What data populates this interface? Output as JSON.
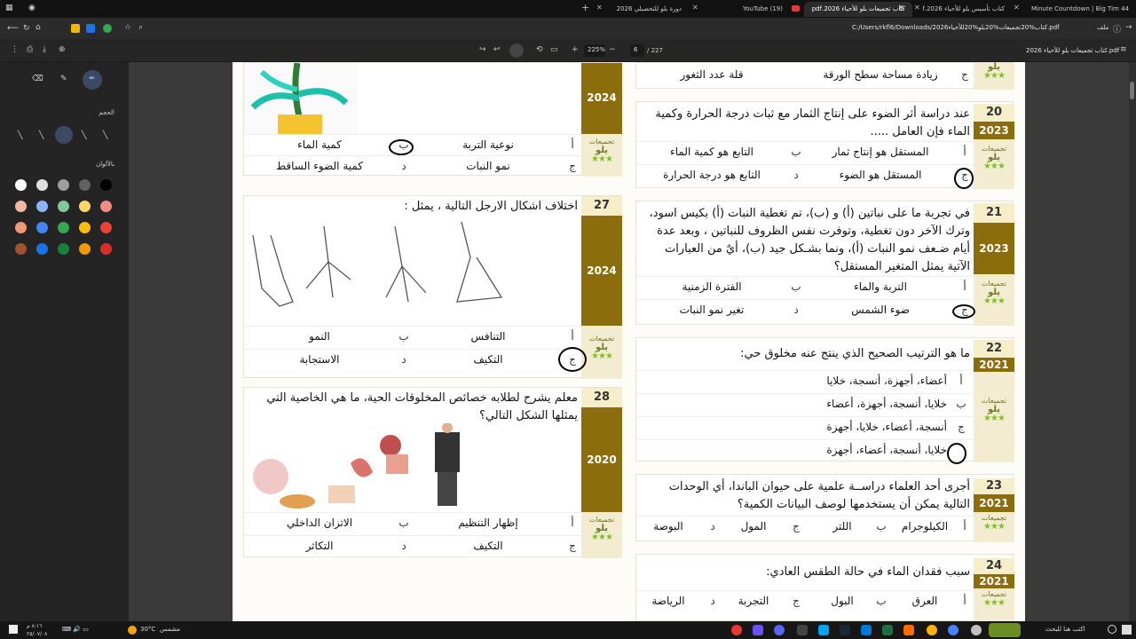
{
  "browser": {
    "tabs": [
      {
        "label": "44 Minute Countdown | Big Tim"
      },
      {
        "label": "كتاب تأسيس يلو للأحياء 2026.pdf"
      },
      {
        "label": "كتاب تجميعات يلو للأحياء 2026.pdf"
      },
      {
        "label": "(19) YouTube"
      },
      {
        "label": "دورة يلو للتحصيلي 2026"
      }
    ],
    "new_tab": "+",
    "address_prefix": "ملف",
    "url": "C:/Users/rkfl6/Downloads/2026كتاب%20تجميعات%20يلو%20للأحياء.pdf"
  },
  "pdf_toolbar": {
    "title": "كتاب تجميعات يلو للأحياء 2026.pdf",
    "page_current": "6",
    "page_total": "/ 227",
    "zoom": "225%",
    "minus": "−",
    "plus": "+"
  },
  "sidebar": {
    "size_label": "الحجم",
    "colors_label": "بالألوان",
    "colors": [
      "#ffffff",
      "#e0e0e0",
      "#9e9e9e",
      "#616161",
      "#000000",
      "#f2b8a0",
      "#8ab4f8",
      "#81c995",
      "#fdd663",
      "#f28b82",
      "#ee9a76",
      "#4285f4",
      "#34a853",
      "#fbbc04",
      "#ea4335",
      "#a0522d",
      "#1a73e8",
      "#188038",
      "#f29900",
      "#d93025"
    ]
  },
  "brand_text": "تجميعات",
  "brand_sub": "يلو",
  "stars": "★★★",
  "left_col": {
    "q26_top": {
      "year": "2024",
      "options": [
        {
          "letter": "أ",
          "text": "نوعية التربة"
        },
        {
          "letter": "ب",
          "text": "كمية الماء"
        },
        {
          "letter": "ج",
          "text": "نمو النبات"
        },
        {
          "letter": "د",
          "text": "كمية الضوء الساقط"
        }
      ]
    },
    "q27": {
      "number": "27",
      "year": "2024",
      "text": "اختلاف اشكال الارجل التالية ، يمثل :",
      "options": [
        {
          "letter": "أ",
          "text": "التنافس"
        },
        {
          "letter": "ب",
          "text": "النمو"
        },
        {
          "letter": "ج",
          "text": "التكيف"
        },
        {
          "letter": "د",
          "text": "الاستجابة"
        }
      ]
    },
    "q28": {
      "number": "28",
      "year": "2020",
      "text": "معلم يشرح لطلابه خصائص المخلوقات الحية، ما هي الخاصية التي يمثلها الشكل التالي؟",
      "options": [
        {
          "letter": "أ",
          "text": "إظهار التنظيم"
        },
        {
          "letter": "ب",
          "text": "الاتزان الداخلي"
        },
        {
          "letter": "ج",
          "text": "التكيف"
        },
        {
          "letter": "د",
          "text": "التكاثر"
        }
      ]
    }
  },
  "right_col": {
    "q19_top": {
      "options": [
        {
          "letter": "ج",
          "text": "زيادة مساحة سطح الورقة"
        },
        {
          "letter": "د",
          "text": "قلة عدد الثغور"
        }
      ]
    },
    "q20": {
      "number": "20",
      "year": "2023",
      "text": "عند دراسة أثر الضوء على إنتاج الثمار مع ثبات درجة الحرارة وكمية الماء فإن العامل .....",
      "options": [
        {
          "letter": "أ",
          "text": "المستقل هو إنتاج ثمار"
        },
        {
          "letter": "ب",
          "text": "التابع هو كمية الماء"
        },
        {
          "letter": "ج",
          "text": "المستقل هو الضوء"
        },
        {
          "letter": "د",
          "text": "التابع هو درجة الحرارة"
        }
      ]
    },
    "q21": {
      "number": "21",
      "year": "2023",
      "text": "في تجربة ما على نباتين (أ) و (ب)، تم تغطية النبات (أ) بكيس اسود، وترك الآخر دون تغطية، وتوفرت نفس الظروف للنباتين ، وبعد عدة أيام ضـعف نمو النبات (أ)، ونما بشـكل جيد (ب)، أيٌ من العبارات الآتية يمثل المتغير المستقل؟",
      "options": [
        {
          "letter": "أ",
          "text": "التربة والماء"
        },
        {
          "letter": "ب",
          "text": "الفترة الزمنية"
        },
        {
          "letter": "ج",
          "text": "ضوء الشمس"
        },
        {
          "letter": "د",
          "text": "تغير نمو النبات"
        }
      ]
    },
    "q22": {
      "number": "22",
      "year": "2021",
      "text": "ما هو الترتيب الصحيح الذي ينتج عنه مخلوق حي:",
      "options": [
        {
          "letter": "أ",
          "text": "أعضاء، أجهزة، أنسجة، خلايا"
        },
        {
          "letter": "ب",
          "text": "خلايا، أنسجة، أجهزة، أعضاء"
        },
        {
          "letter": "ج",
          "text": "أنسجة، أعضاء، خلايا، أجهزة"
        },
        {
          "letter": "د",
          "text": "خلايا، أنسجة، أعضاء، أجهزة"
        }
      ]
    },
    "q23": {
      "number": "23",
      "year": "2021",
      "text": "أجرى أحد العلماء دراســة علمية على حيوان الباندا، أي الوحدات التالية يمكن أن يستخدمها لوصف البيانات الكمية؟",
      "options": [
        {
          "letter": "أ",
          "text": "الكيلوجرام"
        },
        {
          "letter": "ب",
          "text": "اللتر"
        },
        {
          "letter": "ج",
          "text": "المول"
        },
        {
          "letter": "د",
          "text": "البوصة"
        }
      ]
    },
    "q24": {
      "number": "24",
      "year": "2021",
      "text": "سبب فقدان الماء في حالة الطقس العادي:",
      "options": [
        {
          "letter": "أ",
          "text": "العرق"
        },
        {
          "letter": "ب",
          "text": "البول"
        },
        {
          "letter": "ج",
          "text": "التجربة"
        },
        {
          "letter": "د",
          "text": "الرياضة"
        }
      ]
    }
  },
  "taskbar": {
    "weather": "30°C",
    "weather_desc": "مشمس",
    "search": "اكتب هنا للبحث",
    "time": "٨:١٦ م",
    "date": "٢٥/٠٧/٠٨"
  }
}
